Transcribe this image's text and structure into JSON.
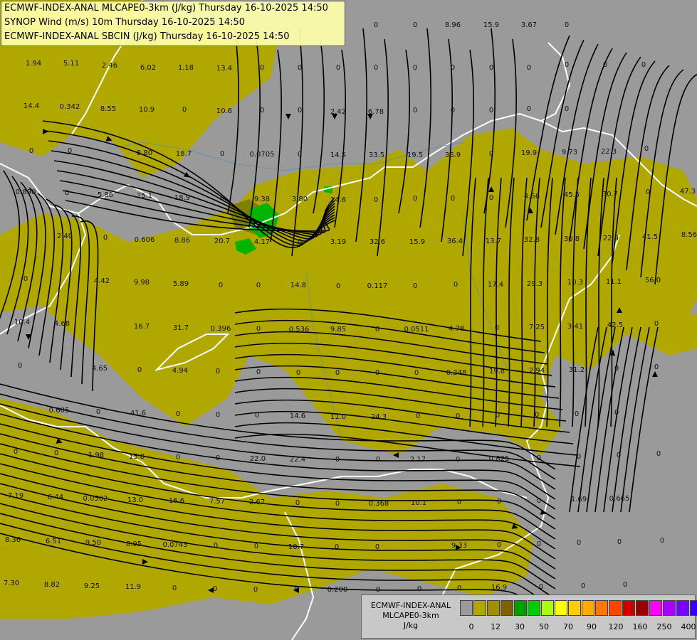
{
  "header": {
    "line1": "ECMWF-INDEX-ANAL MLCAPE0-3km (J/kg) Thursday 16-10-2025 14:50",
    "line2": "SYNOP Wind (m/s) 10m Thursday 16-10-2025 14:50",
    "line3": "ECMWF-INDEX-ANAL SBCIN (J/kg) Thursday 16-10-2025 14:50"
  },
  "legend": {
    "title1": "ECMWF-INDEX-ANAL",
    "title2": "MLCAPE0-3km",
    "unit": "J/kg",
    "colors": [
      "#9a9a9a",
      "#b0a800",
      "#a09000",
      "#806000",
      "#00a000",
      "#00cc00",
      "#aaff00",
      "#ffff00",
      "#ffcc00",
      "#ffaa00",
      "#ff7700",
      "#ff4400",
      "#cc0000",
      "#990000",
      "#ff00ff",
      "#aa00ff",
      "#7700ff",
      "#3300ff",
      "#0000ff",
      "#00aaff",
      "#00ffff",
      "#aaffff",
      "#ffffff"
    ],
    "ticks": [
      "0",
      "12",
      "30",
      "50",
      "70",
      "90",
      "120",
      "160",
      "250",
      "400"
    ]
  },
  "colors": {
    "cape_low": "#b0a800",
    "background": "#9a9a9a",
    "streamline": "#000000",
    "border": "#ffffff"
  },
  "values": [
    {
      "t": "0"
    },
    {
      "t": "0"
    },
    {
      "t": "8.96"
    },
    {
      "t": "15.9"
    },
    {
      "t": "3.67"
    },
    {
      "t": "0"
    },
    {
      "t": "1.94"
    },
    {
      "t": "5.11"
    },
    {
      "t": "2.46"
    },
    {
      "t": "6.02"
    },
    {
      "t": "1.18"
    },
    {
      "t": "13.4"
    },
    {
      "t": "0"
    },
    {
      "t": "0"
    },
    {
      "t": "0"
    },
    {
      "t": "0"
    },
    {
      "t": "0"
    },
    {
      "t": "0"
    },
    {
      "t": "0"
    },
    {
      "t": "0"
    },
    {
      "t": "0"
    },
    {
      "t": "0"
    },
    {
      "t": "0"
    },
    {
      "t": "14.4"
    },
    {
      "t": "0.342"
    },
    {
      "t": "8.55"
    },
    {
      "t": "10.9"
    },
    {
      "t": "0"
    },
    {
      "t": "10.6"
    },
    {
      "t": "0"
    },
    {
      "t": "0"
    },
    {
      "t": "2.42"
    },
    {
      "t": "6.78"
    },
    {
      "t": "0"
    },
    {
      "t": "0"
    },
    {
      "t": "0"
    },
    {
      "t": "0"
    },
    {
      "t": "0"
    },
    {
      "t": "0"
    },
    {
      "t": "0"
    },
    {
      "t": "8.80"
    },
    {
      "t": "18.7"
    },
    {
      "t": "0"
    },
    {
      "t": "0.0705"
    },
    {
      "t": "0"
    },
    {
      "t": "14.5"
    },
    {
      "t": "33.5"
    },
    {
      "t": "19.5"
    },
    {
      "t": "36.9"
    },
    {
      "t": "0"
    },
    {
      "t": "19.9"
    },
    {
      "t": "9.73"
    },
    {
      "t": "22.3"
    },
    {
      "t": "0"
    },
    {
      "t": "0.890"
    },
    {
      "t": "0"
    },
    {
      "t": "5.86"
    },
    {
      "t": "25.1"
    },
    {
      "t": "18.9"
    },
    {
      "t": "0"
    },
    {
      "t": "9.38"
    },
    {
      "t": "3.80"
    },
    {
      "t": "14.6"
    },
    {
      "t": "0"
    },
    {
      "t": "0"
    },
    {
      "t": "0"
    },
    {
      "t": "0"
    },
    {
      "t": "4.56"
    },
    {
      "t": "45.5"
    },
    {
      "t": "30.7"
    },
    {
      "t": "0"
    },
    {
      "t": "47.3"
    },
    {
      "t": "2.40"
    },
    {
      "t": "0"
    },
    {
      "t": "0.606"
    },
    {
      "t": "8.86"
    },
    {
      "t": "20.7"
    },
    {
      "t": "4.17"
    },
    {
      "t": "0"
    },
    {
      "t": "3.19"
    },
    {
      "t": "32.6"
    },
    {
      "t": "15.9"
    },
    {
      "t": "36.4"
    },
    {
      "t": "13.7"
    },
    {
      "t": "32.8"
    },
    {
      "t": "30.8"
    },
    {
      "t": "22.9"
    },
    {
      "t": "41.5"
    },
    {
      "t": "8.56"
    },
    {
      "t": "0"
    },
    {
      "t": "4.42"
    },
    {
      "t": "9.98"
    },
    {
      "t": "5.89"
    },
    {
      "t": "0"
    },
    {
      "t": "0"
    },
    {
      "t": "14.8"
    },
    {
      "t": "0"
    },
    {
      "t": "0.117"
    },
    {
      "t": "0"
    },
    {
      "t": "0"
    },
    {
      "t": "17.4"
    },
    {
      "t": "29.3"
    },
    {
      "t": "10.3"
    },
    {
      "t": "11.1"
    },
    {
      "t": "56.0"
    },
    {
      "t": "10.4"
    },
    {
      "t": "4.68"
    },
    {
      "t": "16.7"
    },
    {
      "t": "31.7"
    },
    {
      "t": "0.396"
    },
    {
      "t": "0"
    },
    {
      "t": "0.536"
    },
    {
      "t": "9.85"
    },
    {
      "t": "0"
    },
    {
      "t": "0.0511"
    },
    {
      "t": "4.78"
    },
    {
      "t": "0"
    },
    {
      "t": "7.25"
    },
    {
      "t": "3.41"
    },
    {
      "t": "42.5"
    },
    {
      "t": "0"
    },
    {
      "t": "0"
    },
    {
      "t": "4.65"
    },
    {
      "t": "0"
    },
    {
      "t": "4.94"
    },
    {
      "t": "0"
    },
    {
      "t": "0"
    },
    {
      "t": "0"
    },
    {
      "t": "0"
    },
    {
      "t": "0"
    },
    {
      "t": "0"
    },
    {
      "t": "0.248"
    },
    {
      "t": "19.8"
    },
    {
      "t": "2.94"
    },
    {
      "t": "31.2"
    },
    {
      "t": "0"
    },
    {
      "t": "0"
    },
    {
      "t": "0.605"
    },
    {
      "t": "0"
    },
    {
      "t": "41.6"
    },
    {
      "t": "0"
    },
    {
      "t": "0"
    },
    {
      "t": "0"
    },
    {
      "t": "14.6"
    },
    {
      "t": "11.0"
    },
    {
      "t": "24.3"
    },
    {
      "t": "0"
    },
    {
      "t": "0"
    },
    {
      "t": "0"
    },
    {
      "t": "0"
    },
    {
      "t": "0"
    },
    {
      "t": "0"
    },
    {
      "t": "0"
    },
    {
      "t": "0"
    },
    {
      "t": "1.98"
    },
    {
      "t": "15.8"
    },
    {
      "t": "0"
    },
    {
      "t": "0"
    },
    {
      "t": "22.0"
    },
    {
      "t": "22.4"
    },
    {
      "t": "0"
    },
    {
      "t": "0"
    },
    {
      "t": "2.17"
    },
    {
      "t": "0"
    },
    {
      "t": "0.825"
    },
    {
      "t": "0"
    },
    {
      "t": "0"
    },
    {
      "t": "0"
    },
    {
      "t": "0"
    },
    {
      "t": "7.19"
    },
    {
      "t": "6.44"
    },
    {
      "t": "0.0502"
    },
    {
      "t": "13.0"
    },
    {
      "t": "16.6"
    },
    {
      "t": "7.57"
    },
    {
      "t": "2.67"
    },
    {
      "t": "0"
    },
    {
      "t": "0"
    },
    {
      "t": "0.368"
    },
    {
      "t": "10.1"
    },
    {
      "t": "0"
    },
    {
      "t": "0"
    },
    {
      "t": "0"
    },
    {
      "t": "1.69"
    },
    {
      "t": "0.665"
    },
    {
      "t": "8.36"
    },
    {
      "t": "6.51"
    },
    {
      "t": "9.50"
    },
    {
      "t": "8.95"
    },
    {
      "t": "0.0743"
    },
    {
      "t": "0"
    },
    {
      "t": "0"
    },
    {
      "t": "10.7"
    },
    {
      "t": "0"
    },
    {
      "t": "0"
    },
    {
      "t": "9.33"
    },
    {
      "t": "0"
    },
    {
      "t": "0"
    },
    {
      "t": "0"
    },
    {
      "t": "0"
    },
    {
      "t": "0"
    },
    {
      "t": "7.30"
    },
    {
      "t": "8.82"
    },
    {
      "t": "9.25"
    },
    {
      "t": "11.9"
    },
    {
      "t": "0"
    },
    {
      "t": "0"
    },
    {
      "t": "0"
    },
    {
      "t": "0"
    },
    {
      "t": "0.200"
    },
    {
      "t": "0"
    },
    {
      "t": "0"
    },
    {
      "t": "0"
    },
    {
      "t": "16.9"
    },
    {
      "t": "0"
    },
    {
      "t": "0"
    },
    {
      "t": "0"
    }
  ]
}
